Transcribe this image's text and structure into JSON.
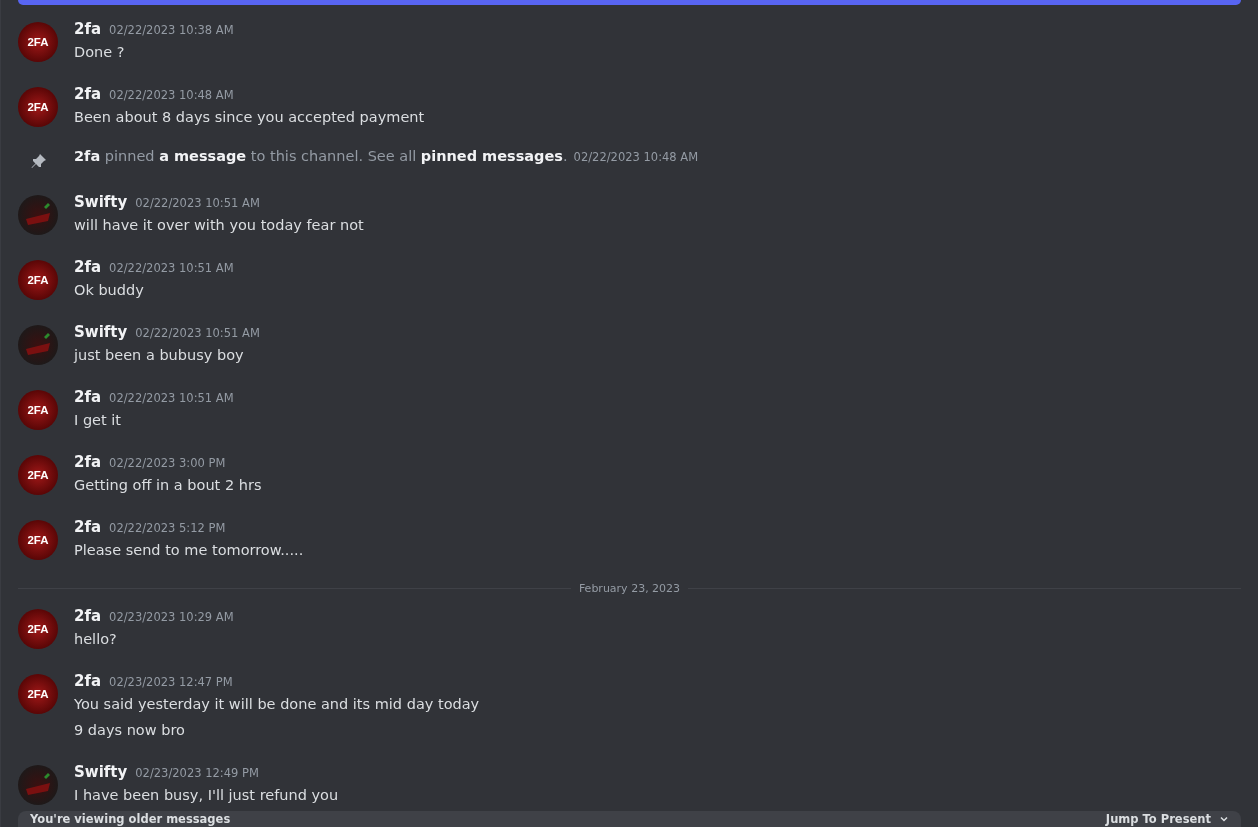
{
  "items": [
    {
      "kind": "message",
      "author": "2fa",
      "avatar_text": "2FA",
      "time": "02/22/2023 10:38 AM",
      "lines": [
        "Done ?"
      ]
    },
    {
      "kind": "message",
      "author": "2fa",
      "avatar_text": "2FA",
      "time": "02/22/2023 10:48 AM",
      "lines": [
        "Been about 8 days since you accepted payment"
      ]
    },
    {
      "kind": "pin",
      "text": "**2fa** pinned **a message** to this channel. See all **pinned messages**.",
      "time": "02/22/2023 10:48 AM"
    },
    {
      "kind": "message",
      "author": "Swifty",
      "time": "02/22/2023 10:51 AM",
      "lines": [
        "will have it over with you today fear not"
      ]
    },
    {
      "kind": "message",
      "author": "2fa",
      "avatar_text": "2FA",
      "time": "02/22/2023 10:51 AM",
      "lines": [
        "Ok buddy"
      ]
    },
    {
      "kind": "message",
      "author": "Swifty",
      "time": "02/22/2023 10:51 AM",
      "lines": [
        "just been a bubusy boy"
      ]
    },
    {
      "kind": "message",
      "author": "2fa",
      "avatar_text": "2FA",
      "time": "02/22/2023 10:51 AM",
      "lines": [
        "I get it"
      ]
    },
    {
      "kind": "message",
      "author": "2fa",
      "avatar_text": "2FA",
      "time": "02/22/2023 3:00 PM",
      "lines": [
        "Getting off in a bout 2 hrs"
      ]
    },
    {
      "kind": "message",
      "author": "2fa",
      "avatar_text": "2FA",
      "time": "02/22/2023 5:12 PM",
      "lines": [
        "Please send to me tomorrow....."
      ]
    },
    {
      "kind": "divider",
      "text": "February 23, 2023"
    },
    {
      "kind": "message",
      "author": "2fa",
      "avatar_text": "2FA",
      "time": "02/23/2023 10:29 AM",
      "lines": [
        "hello?"
      ]
    },
    {
      "kind": "message",
      "author": "2fa",
      "avatar_text": "2FA",
      "time": "02/23/2023 12:47 PM",
      "lines": [
        "You said yesterday it will be done and its mid day today",
        "9 days now bro"
      ]
    },
    {
      "kind": "message",
      "author": "Swifty",
      "time": "02/23/2023 12:49 PM",
      "lines": [
        "I have been busy, I'll just refund you"
      ]
    }
  ],
  "older_bar": {
    "text": "You're viewing older messages",
    "button": "Jump To Present"
  }
}
